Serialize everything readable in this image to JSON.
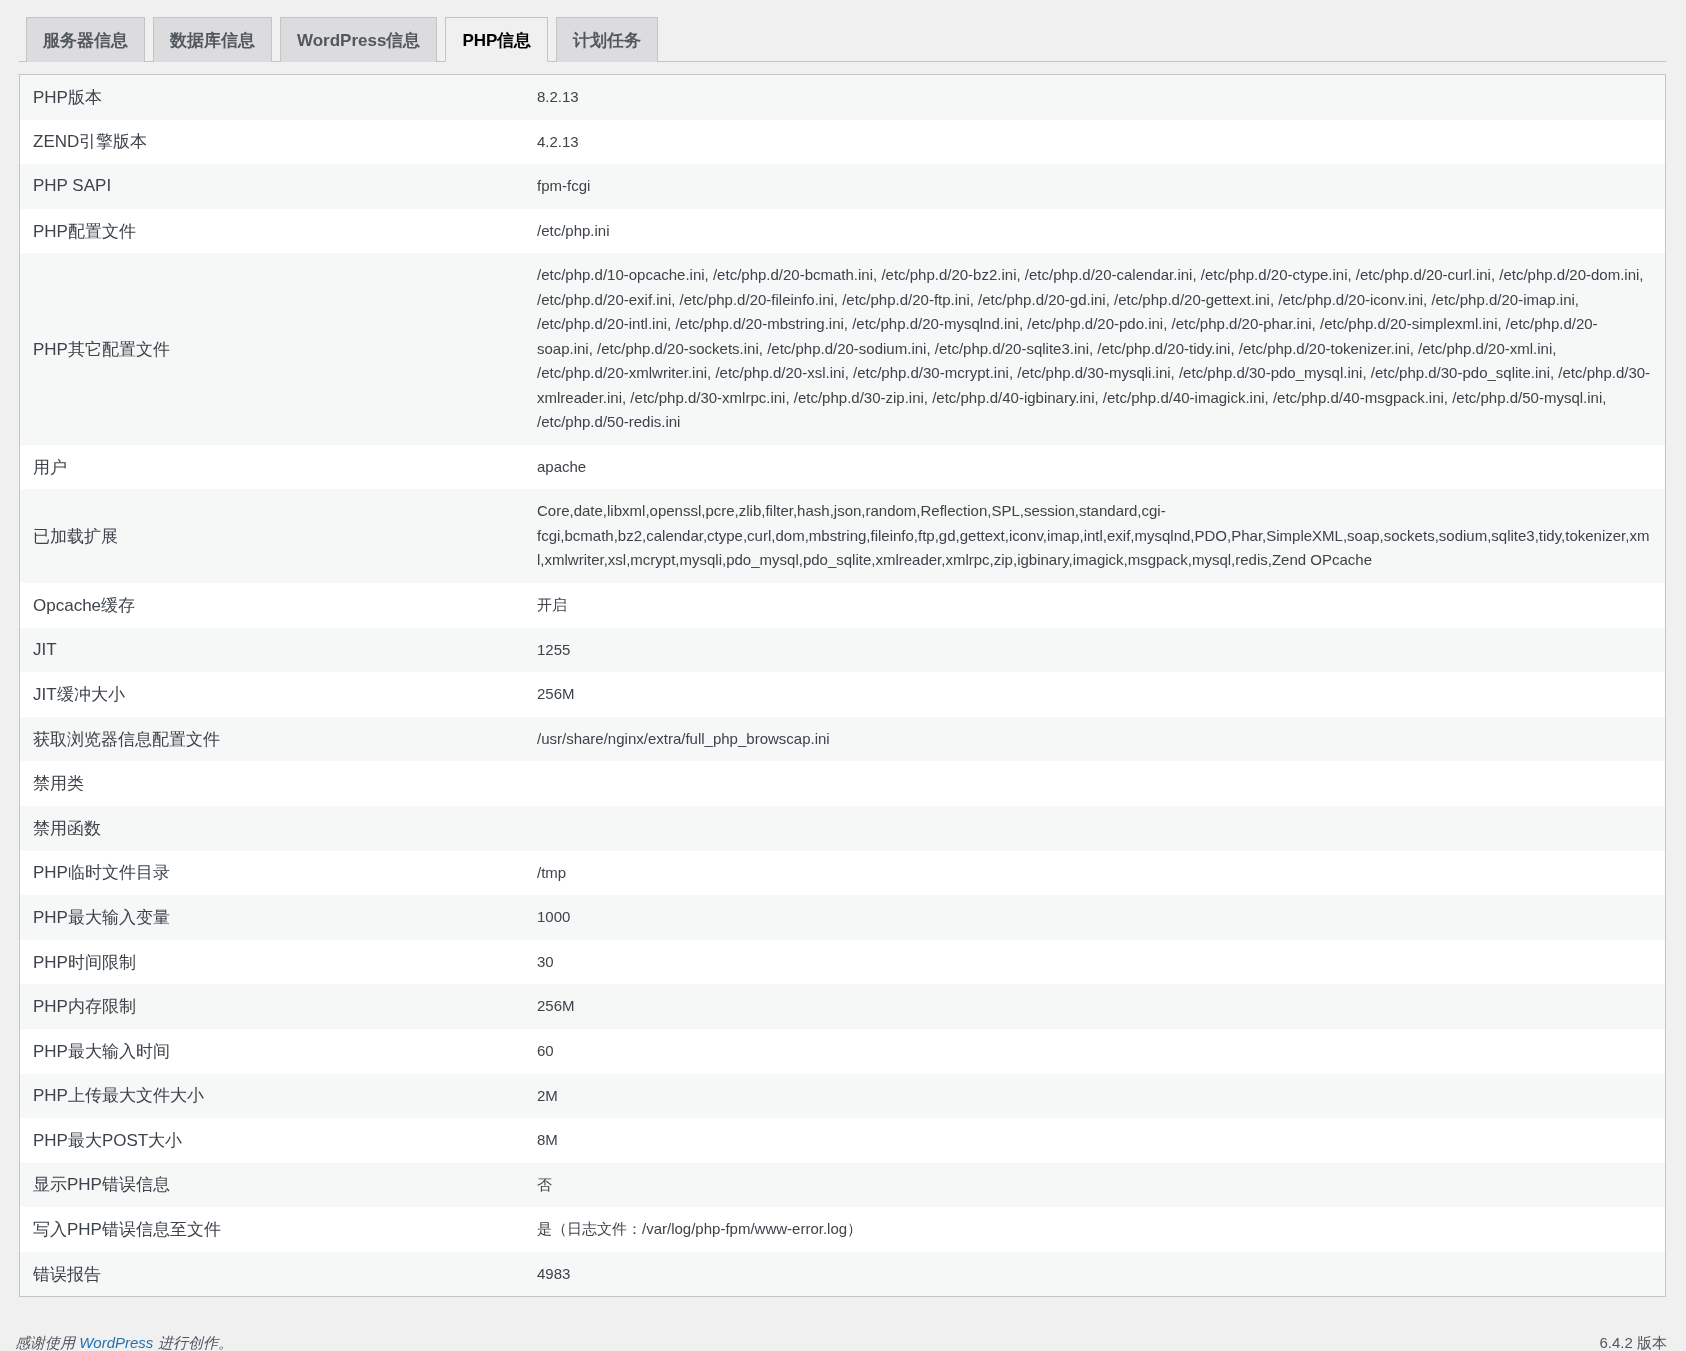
{
  "tabs": [
    {
      "label": "服务器信息",
      "selected": false
    },
    {
      "label": "数据库信息",
      "selected": false
    },
    {
      "label": "WordPress信息",
      "selected": false
    },
    {
      "label": "PHP信息",
      "selected": true
    },
    {
      "label": "计划任务",
      "selected": false
    }
  ],
  "rows": [
    {
      "label": "PHP版本",
      "value": "8.2.13"
    },
    {
      "label": "ZEND引擎版本",
      "value": "4.2.13"
    },
    {
      "label": "PHP SAPI",
      "value": "fpm-fcgi"
    },
    {
      "label": "PHP配置文件",
      "value": "/etc/php.ini"
    },
    {
      "label": "PHP其它配置文件",
      "value": "/etc/php.d/10-opcache.ini, /etc/php.d/20-bcmath.ini, /etc/php.d/20-bz2.ini, /etc/php.d/20-calendar.ini, /etc/php.d/20-ctype.ini, /etc/php.d/20-curl.ini, /etc/php.d/20-dom.ini, /etc/php.d/20-exif.ini, /etc/php.d/20-fileinfo.ini, /etc/php.d/20-ftp.ini, /etc/php.d/20-gd.ini, /etc/php.d/20-gettext.ini, /etc/php.d/20-iconv.ini, /etc/php.d/20-imap.ini, /etc/php.d/20-intl.ini, /etc/php.d/20-mbstring.ini, /etc/php.d/20-mysqlnd.ini, /etc/php.d/20-pdo.ini, /etc/php.d/20-phar.ini, /etc/php.d/20-simplexml.ini, /etc/php.d/20-soap.ini, /etc/php.d/20-sockets.ini, /etc/php.d/20-sodium.ini, /etc/php.d/20-sqlite3.ini, /etc/php.d/20-tidy.ini, /etc/php.d/20-tokenizer.ini, /etc/php.d/20-xml.ini, /etc/php.d/20-xmlwriter.ini, /etc/php.d/20-xsl.ini, /etc/php.d/30-mcrypt.ini, /etc/php.d/30-mysqli.ini, /etc/php.d/30-pdo_mysql.ini, /etc/php.d/30-pdo_sqlite.ini, /etc/php.d/30-xmlreader.ini, /etc/php.d/30-xmlrpc.ini, /etc/php.d/30-zip.ini, /etc/php.d/40-igbinary.ini, /etc/php.d/40-imagick.ini, /etc/php.d/40-msgpack.ini, /etc/php.d/50-mysql.ini, /etc/php.d/50-redis.ini"
    },
    {
      "label": "用户",
      "value": "apache"
    },
    {
      "label": "已加载扩展",
      "value": "Core,date,libxml,openssl,pcre,zlib,filter,hash,json,random,Reflection,SPL,session,standard,cgi-fcgi,bcmath,bz2,calendar,ctype,curl,dom,mbstring,fileinfo,ftp,gd,gettext,iconv,imap,intl,exif,mysqlnd,PDO,Phar,SimpleXML,soap,sockets,sodium,sqlite3,tidy,tokenizer,xml,xmlwriter,xsl,mcrypt,mysqli,pdo_mysql,pdo_sqlite,xmlreader,xmlrpc,zip,igbinary,imagick,msgpack,mysql,redis,Zend OPcache"
    },
    {
      "label": "Opcache缓存",
      "value": "开启"
    },
    {
      "label": "JIT",
      "value": "1255"
    },
    {
      "label": "JIT缓冲大小",
      "value": "256M"
    },
    {
      "label": "获取浏览器信息配置文件",
      "value": "/usr/share/nginx/extra/full_php_browscap.ini"
    },
    {
      "label": "禁用类"
    },
    {
      "label": "禁用函数"
    },
    {
      "label": "PHP临时文件目录",
      "value": "/tmp"
    },
    {
      "label": "PHP最大输入变量",
      "value": "1000"
    },
    {
      "label": "PHP时间限制",
      "value": "30"
    },
    {
      "label": "PHP内存限制",
      "value": "256M"
    },
    {
      "label": "PHP最大输入时间",
      "value": "60"
    },
    {
      "label": "PHP上传最大文件大小",
      "value": "2M"
    },
    {
      "label": "PHP最大POST大小",
      "value": "8M"
    },
    {
      "label": "显示PHP错误信息",
      "value": "否"
    },
    {
      "label": "写入PHP错误信息至文件",
      "value": "是（日志文件：/var/log/php-fpm/www-error.log）"
    },
    {
      "label": "错误报告",
      "value": "4983"
    }
  ],
  "footer": {
    "credit_prefix": "感谢使用",
    "credit_link": "WordPress",
    "credit_suffix": "进行创作。",
    "version": "6.4.2 版本"
  }
}
